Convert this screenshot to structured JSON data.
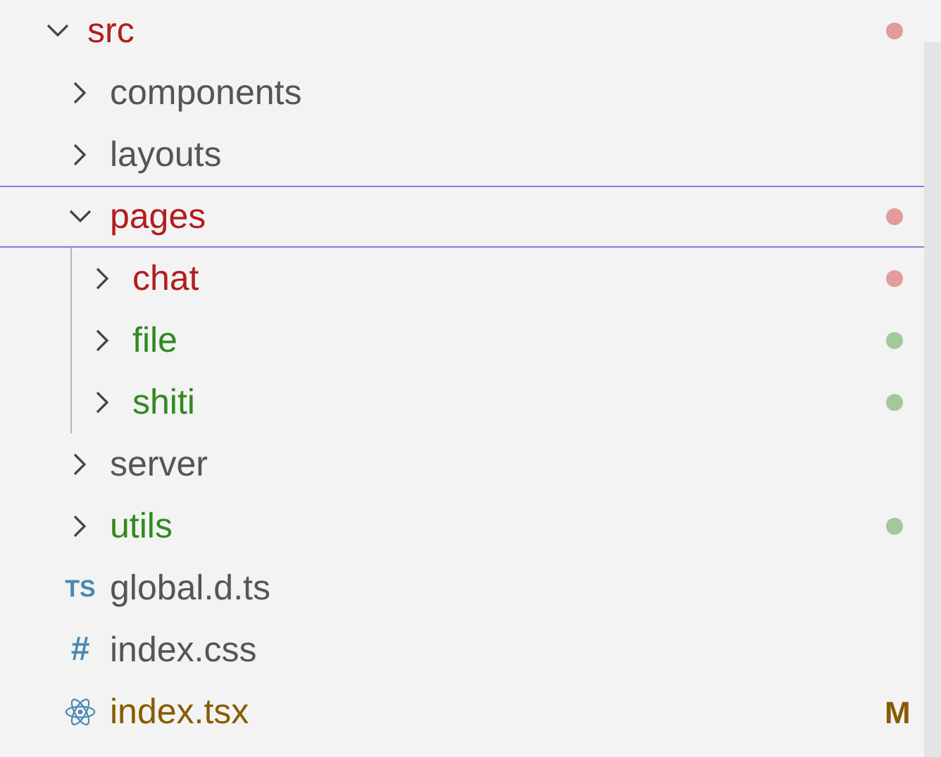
{
  "tree": [
    {
      "name": "src",
      "kind": "folder",
      "expanded": true,
      "focused": false,
      "error": true,
      "untracked": false,
      "modified": false,
      "children": [
        {
          "name": "components",
          "kind": "folder",
          "expanded": false,
          "focused": false,
          "error": false,
          "untracked": false,
          "modified": false
        },
        {
          "name": "layouts",
          "kind": "folder",
          "expanded": false,
          "focused": false,
          "error": false,
          "untracked": false,
          "modified": false
        },
        {
          "name": "pages",
          "kind": "folder",
          "expanded": true,
          "focused": true,
          "error": true,
          "untracked": false,
          "modified": false,
          "children": [
            {
              "name": "chat",
              "kind": "folder",
              "expanded": false,
              "focused": false,
              "error": true,
              "untracked": false,
              "modified": false
            },
            {
              "name": "file",
              "kind": "folder",
              "expanded": false,
              "focused": false,
              "error": false,
              "untracked": true,
              "modified": false
            },
            {
              "name": "shiti",
              "kind": "folder",
              "expanded": false,
              "focused": false,
              "error": false,
              "untracked": true,
              "modified": false
            }
          ]
        },
        {
          "name": "server",
          "kind": "folder",
          "expanded": false,
          "focused": false,
          "error": false,
          "untracked": false,
          "modified": false
        },
        {
          "name": "utils",
          "kind": "folder",
          "expanded": false,
          "focused": false,
          "error": false,
          "untracked": true,
          "modified": false
        },
        {
          "name": "global.d.ts",
          "kind": "typescript",
          "focused": false,
          "error": false,
          "untracked": false,
          "modified": false,
          "icon_text": "TS"
        },
        {
          "name": "index.css",
          "kind": "stylesheet",
          "focused": false,
          "error": false,
          "untracked": false,
          "modified": false,
          "icon_text": "#"
        },
        {
          "name": "index.tsx",
          "kind": "react",
          "focused": false,
          "error": false,
          "untracked": false,
          "modified": true,
          "badge": "M"
        }
      ]
    }
  ]
}
